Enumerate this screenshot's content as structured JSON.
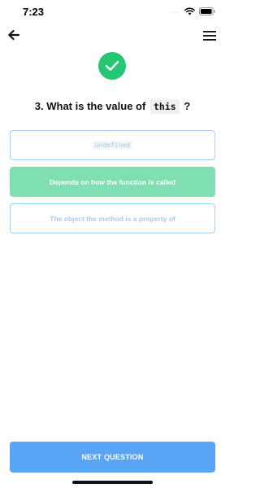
{
  "status_bar": {
    "time": "7:23",
    "signal": "....",
    "icons": [
      "wifi-icon",
      "battery-icon"
    ]
  },
  "nav": {
    "back_icon": "arrow-left-icon",
    "menu_icon": "hamburger-menu-icon"
  },
  "result": {
    "icon": "checkmark-icon",
    "color": "#25c674"
  },
  "question": {
    "prefix": "3. What is the value of",
    "code": "this",
    "suffix": "?"
  },
  "answers": [
    {
      "label": "undefined",
      "is_code": true,
      "state": "default"
    },
    {
      "label": "Depends on how the function is called",
      "is_code": false,
      "state": "correct"
    },
    {
      "label": "The object the method is a property of",
      "is_code": false,
      "state": "default"
    }
  ],
  "next_button": {
    "label": "NEXT QUESTION",
    "color": "#5aa4f6"
  },
  "colors": {
    "correct": "#7fdfb2",
    "outline": "#a5cdf8",
    "check": "#25c674"
  }
}
